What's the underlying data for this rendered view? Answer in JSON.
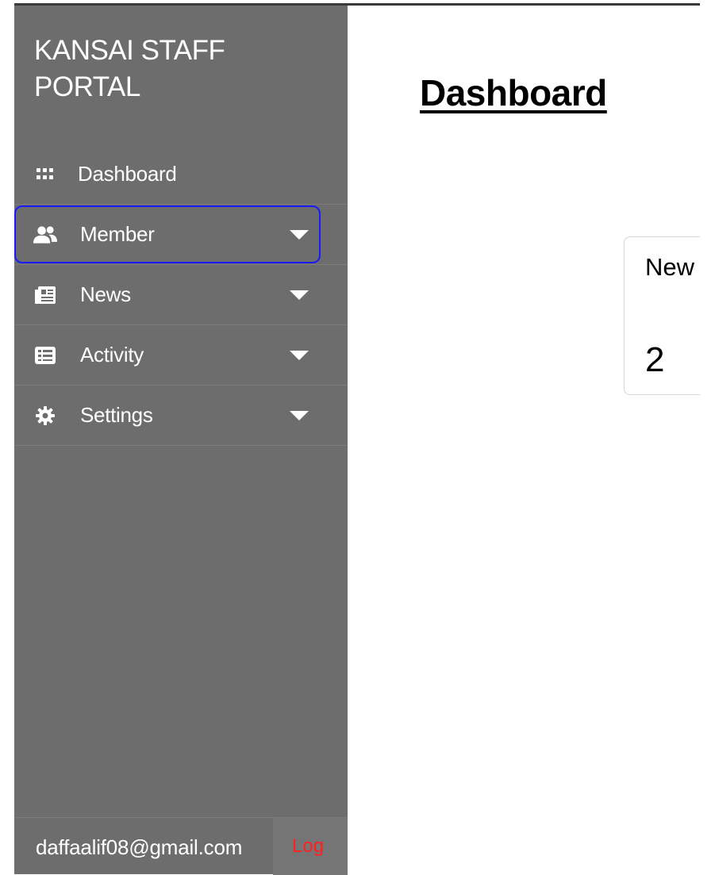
{
  "sidebar": {
    "brand": "KANSAI STAFF PORTAL",
    "items": [
      {
        "label": "Dashboard",
        "icon": "grid-icon",
        "has_caret": false
      },
      {
        "label": "Member",
        "icon": "users-icon",
        "has_caret": true,
        "active": true
      },
      {
        "label": "News",
        "icon": "newspaper-icon",
        "has_caret": true
      },
      {
        "label": "Activity",
        "icon": "list-icon",
        "has_caret": true
      },
      {
        "label": "Settings",
        "icon": "gear-icon",
        "has_caret": true
      }
    ],
    "footer": {
      "email": "daffaalif08@gmail.com",
      "logout_label": "Log"
    }
  },
  "main": {
    "title": "Dashboard",
    "card": {
      "title": "New",
      "value": "2"
    }
  },
  "colors": {
    "sidebar_bg": "#6d6d6d",
    "active_border": "#1a1aff",
    "logout_text": "#ff2020"
  }
}
